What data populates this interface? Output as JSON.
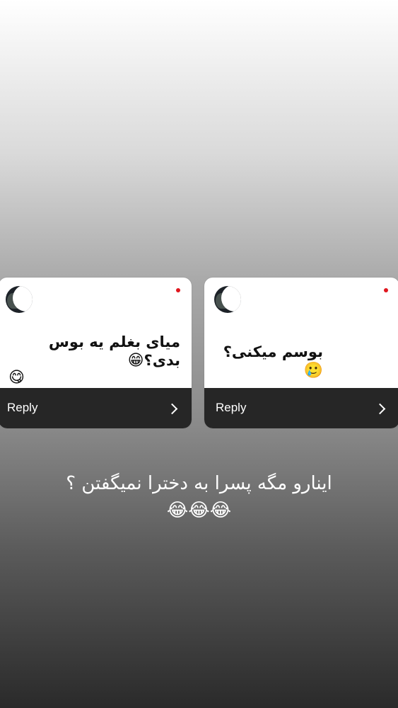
{
  "story": {
    "background_colors": [
      "#ffffff",
      "#a8a8a8",
      "#2a2a2a"
    ],
    "cards": [
      {
        "message": "میای بغلم یه بوس بدی؟",
        "emojis": [
          "😁",
          "😋"
        ],
        "reply_label": "Reply",
        "unread": true
      },
      {
        "message": "بوسم میکنی؟",
        "emojis": [
          "🥲"
        ],
        "reply_label": "Reply",
        "unread": true
      }
    ],
    "caption": {
      "text": "اینارو مگه پسرا به دخترا نمیگفتن ؟",
      "emojis": [
        "😂",
        "😂",
        "😂"
      ]
    },
    "accent_color": "#e0161e",
    "reply_bar_color": "#262626"
  }
}
